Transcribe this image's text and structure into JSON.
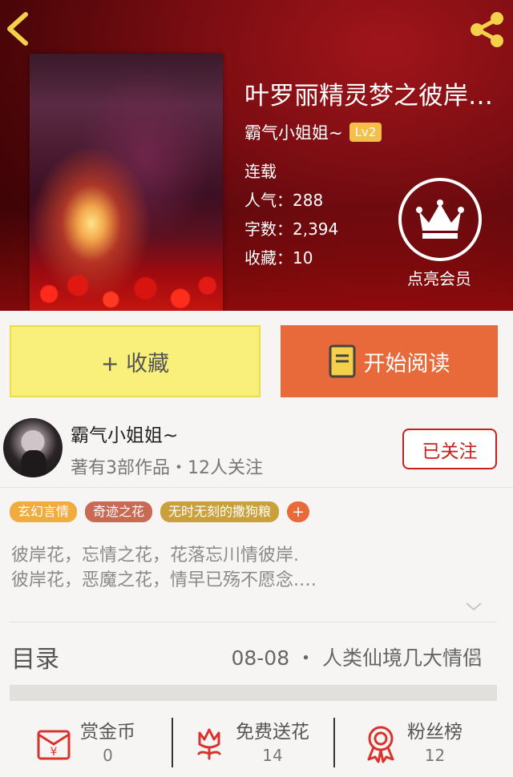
{
  "book": {
    "title": "叶罗丽精灵梦之彼岸…",
    "author": "霸气小姐姐~",
    "level": "Lv2",
    "status": "连载",
    "popularity": "人气：288",
    "word_count": "字数：2,394",
    "favorites": "收藏：10",
    "member_label": "点亮会员"
  },
  "actions": {
    "collect_label": "+ 收藏",
    "read_label": "开始阅读"
  },
  "author_card": {
    "name": "霸气小姐姐~",
    "meta": "著有3部作品・12人关注",
    "follow_label": "已关注"
  },
  "tags": [
    {
      "label": "玄幻言情",
      "color": "#f0ac3e"
    },
    {
      "label": "奇迹之花",
      "color": "#c96a55"
    },
    {
      "label": "无时无刻的撒狗粮",
      "color": "#c9a03a"
    }
  ],
  "tag_add": "+",
  "description": {
    "line1": "彼岸花，忘情之花，花落忘川情彼岸.",
    "line2": "彼岸花，恶魔之花，情早已殇不愿念.…"
  },
  "toc": {
    "label": "目录",
    "latest": "08-08 ・ 人类仙境几大情侣"
  },
  "bottom": {
    "reward_label": "赏金币",
    "reward_value": "0",
    "flower_label": "免费送花",
    "flower_value": "14",
    "fans_label": "粉丝榜",
    "fans_value": "12"
  },
  "colors": {
    "accent": "#e8693a",
    "collect_bg": "#f8f07a",
    "follow": "#c8201c",
    "icon_red": "#d9332c"
  }
}
